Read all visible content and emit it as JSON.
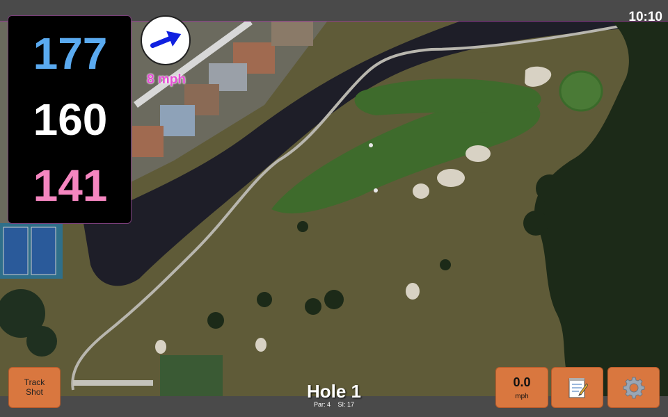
{
  "status": {
    "time": "10:10"
  },
  "distances": {
    "back": "177",
    "middle": "160",
    "front": "141"
  },
  "wind": {
    "speed": "8 mph",
    "direction_icon": "arrow-right-icon"
  },
  "hole": {
    "title": "Hole 1",
    "par": "Par: 4",
    "stroke_index": "SI: 17"
  },
  "buttons": {
    "track_shot": "Track Shot",
    "speed_value": "0.0",
    "speed_unit": "mph",
    "notes_icon": "notepad-icon",
    "settings_icon": "gear-icon"
  },
  "colors": {
    "back_distance": "#5aaaf0",
    "middle_distance": "#ffffff",
    "front_distance": "#f586c0",
    "wind_label": "#e64fd6",
    "button_bg": "#d9773f"
  }
}
